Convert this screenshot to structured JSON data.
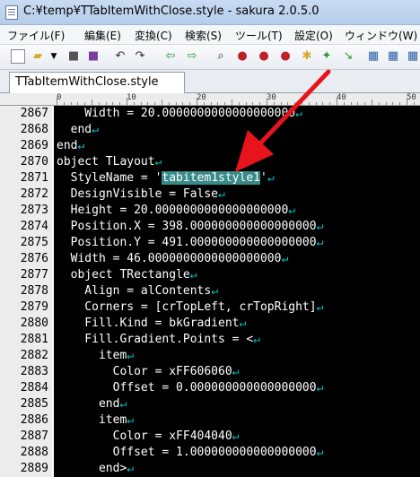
{
  "window": {
    "title": "C:¥temp¥TTabItemWithClose.style - sakura 2.0.5.0"
  },
  "menu": [
    {
      "label": "ファイル(F)"
    },
    {
      "label": "編集(E)"
    },
    {
      "label": "変換(C)"
    },
    {
      "label": "検索(S)"
    },
    {
      "label": "ツール(T)"
    },
    {
      "label": "設定(O)"
    },
    {
      "label": "ウィンドウ(W)"
    }
  ],
  "toolbar": {
    "icons": [
      "new-file-icon",
      "open-folder-icon",
      "dropdown-icon",
      "save-icon",
      "save-all-icon",
      "undo-icon",
      "redo-icon",
      "back-icon",
      "forward-icon",
      "search-icon",
      "find-prev-icon",
      "find-next-icon",
      "replace-icon",
      "mark-icon",
      "grep-icon",
      "jump-icon",
      "settings-icon",
      "font-icon",
      "type-icon"
    ]
  },
  "tab": {
    "label": "TTabItemWithClose.style"
  },
  "ruler": {
    "marks": [
      "0",
      "10",
      "20",
      "30",
      "40",
      "50"
    ]
  },
  "editor": {
    "eol_glyph": "↵",
    "lines": [
      {
        "num": "2867",
        "text": "    Width = 20.0000000000000000000"
      },
      {
        "num": "2868",
        "text": "  end"
      },
      {
        "num": "2869",
        "text": "end"
      },
      {
        "num": "2870",
        "text": "object TLayout"
      },
      {
        "num": "2871",
        "pre": "  StyleName = '",
        "sel": "tabitem1style1",
        "post": "'"
      },
      {
        "num": "2872",
        "text": "  DesignVisible = False"
      },
      {
        "num": "2873",
        "text": "  Height = 20.0000000000000000000"
      },
      {
        "num": "2874",
        "text": "  Position.X = 398.000000000000000000"
      },
      {
        "num": "2875",
        "text": "  Position.Y = 491.000000000000000000"
      },
      {
        "num": "2876",
        "text": "  Width = 46.0000000000000000000"
      },
      {
        "num": "2877",
        "text": "  object TRectangle"
      },
      {
        "num": "2878",
        "text": "    Align = alContents"
      },
      {
        "num": "2879",
        "text": "    Corners = [crTopLeft, crTopRight]"
      },
      {
        "num": "2880",
        "text": "    Fill.Kind = bkGradient"
      },
      {
        "num": "2881",
        "text": "    Fill.Gradient.Points = <"
      },
      {
        "num": "2882",
        "text": "      item"
      },
      {
        "num": "2883",
        "text": "        Color = xFF606060"
      },
      {
        "num": "2884",
        "text": "        Offset = 0.000000000000000000"
      },
      {
        "num": "2885",
        "text": "      end"
      },
      {
        "num": "2886",
        "text": "      item"
      },
      {
        "num": "2887",
        "text": "        Color = xFF404040"
      },
      {
        "num": "2888",
        "text": "        Offset = 1.000000000000000000"
      },
      {
        "num": "2889",
        "text": "      end>"
      }
    ]
  },
  "colors": {
    "editor_bg": "#000000",
    "text": "#ffffff",
    "eol": "#00c8c8",
    "selection": "#3a8a8a",
    "annotation_arrow": "#e8141c"
  }
}
